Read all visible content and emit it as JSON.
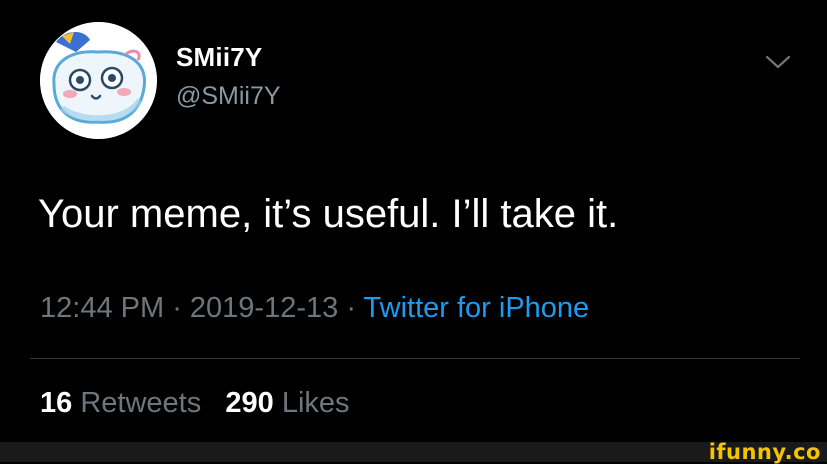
{
  "user": {
    "display_name": "SMii7Y",
    "handle": "@SMii7Y"
  },
  "tweet": {
    "text": "Your meme, it’s useful. I’ll take it.",
    "time": "12:44 PM",
    "separator": " · ",
    "date": "2019-12-13",
    "source": "Twitter for iPhone"
  },
  "stats": {
    "retweets_count": "16",
    "retweets_label": "Retweets",
    "likes_count": "290",
    "likes_label": "Likes"
  },
  "footer": {
    "watermark": "ifunny.co"
  },
  "icons": {
    "menu": "chevron-down-icon",
    "avatar": "pillow-character-avatar"
  },
  "colors": {
    "background": "#000000",
    "text": "#ffffff",
    "secondary": "#6e767d",
    "link": "#1d9bf0",
    "watermark": "#f5c400"
  }
}
